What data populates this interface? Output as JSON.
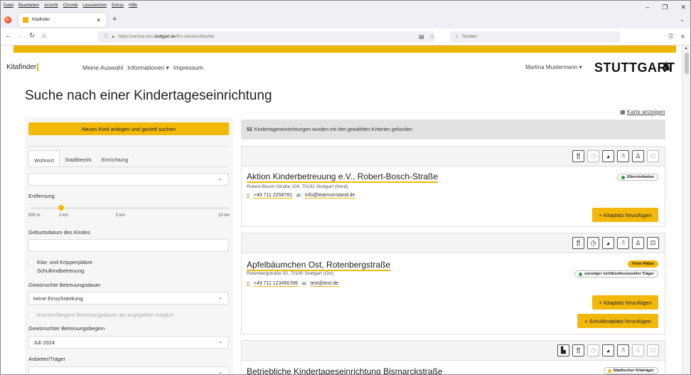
{
  "browser": {
    "menu": [
      "Datei",
      "Bearbeiten",
      "Ansicht",
      "Chronik",
      "Lesezeichen",
      "Extras",
      "Hilfe"
    ],
    "tab_title": "Kitafinder",
    "url_prefix": "https://service.test.",
    "url_domain": "stuttgart.de",
    "url_suffix": "/fhs-services/kita/de/",
    "search_placeholder": "Suchen"
  },
  "header": {
    "brand": "Kitafinder",
    "nav": [
      "Meine Auswahl",
      "Informationen ▾",
      "Impressum"
    ],
    "user": "Martina Mustermann ▾",
    "logo": "STUTTGART"
  },
  "page_title": "Suche nach einer Kindertageseinrichtung",
  "map_link": "Karte anzeigen",
  "filters": {
    "new_child_button": "Neues Kind anlegen und gezielt suchen",
    "tabs": [
      "Wohnort",
      "Stadtbezirk",
      "Einrichtung"
    ],
    "distance_label": "Entfernung",
    "distance_ticks": [
      "500 m",
      "2 km",
      "5 km",
      "10 km"
    ],
    "distance_value_km": 2,
    "birthdate_label": "Geburtsdatum des Kindes",
    "checkbox_kita": "Kita- und Krippenplätze",
    "checkbox_school": "Schulkindbetreuung",
    "duration_label": "Gewünschte Betreuungsdauer",
    "duration_value": "keine Einschränkung",
    "duration_checkbox": "Kürzere/längere Betreuungsdauer als angegeben möglich",
    "start_label": "Gewünschter Betreuungsbeginn",
    "start_value": "Juli 2024",
    "provider_label": "Anbieter/Träger"
  },
  "results": {
    "count": "52",
    "text": "Kindertageseinrichtungen wurden mit den gewählten Kriterien gefunden"
  },
  "cards": [
    {
      "name": "Aktion Kinderbetreuung e.V., Robert-Bosch-Straße",
      "address": "Robert-Bosch-Straße 104, 70192 Stuttgart (Nord)",
      "phone": "+49 711 2258781",
      "email": "info@teamvorstand.de",
      "badge": "Elterninitiative",
      "badge_color": "#2e9e3e",
      "button": "+ Kitaplatz hinzufügen"
    },
    {
      "name": "Apfelbäumchen Ost, Rotenbergstraße",
      "address": "Rotenbergstraße 50, 70190 Stuttgart (Ost)",
      "phone": "+49 711 123456789",
      "email": "test@test.de",
      "badge_free": "Freie Plätze",
      "badge": "sonstiger nichtkonfessioneller Träger",
      "badge_color": "#2e9e3e",
      "button": "+ Kitaplatz hinzufügen",
      "button2": "+ Schulkindplatz hinzufügen"
    },
    {
      "name": "Betriebliche Kindertageseinrichtung Bismarckstraße",
      "badge": "Städtischer Kitaträger",
      "badge_color": "#f2b80a"
    }
  ],
  "colors": {
    "accent": "#f2b80a",
    "brand_bar": "#ecb500"
  }
}
